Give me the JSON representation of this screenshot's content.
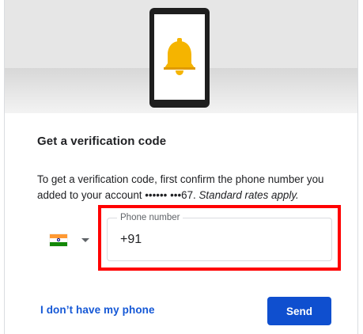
{
  "header": {
    "title": "Get a verification code"
  },
  "description": {
    "text": "To get a verification code, first confirm the phone number you added to your account •••••• •••67. ",
    "rates_note": "Standard rates apply."
  },
  "country_select": {
    "flag": "india-flag",
    "selected_country": "IN"
  },
  "phone_input": {
    "label": "Phone number",
    "value": "+91"
  },
  "actions": {
    "no_phone_label": "I don’t have my phone",
    "send_label": "Send"
  },
  "colors": {
    "accent": "#0f4fcf",
    "link": "#1558d6",
    "highlight": "#ff0000",
    "bell": "#f5b400"
  },
  "icons": {
    "illustration": "phone-with-bell-illustration",
    "dropdown": "caret-down-icon"
  }
}
